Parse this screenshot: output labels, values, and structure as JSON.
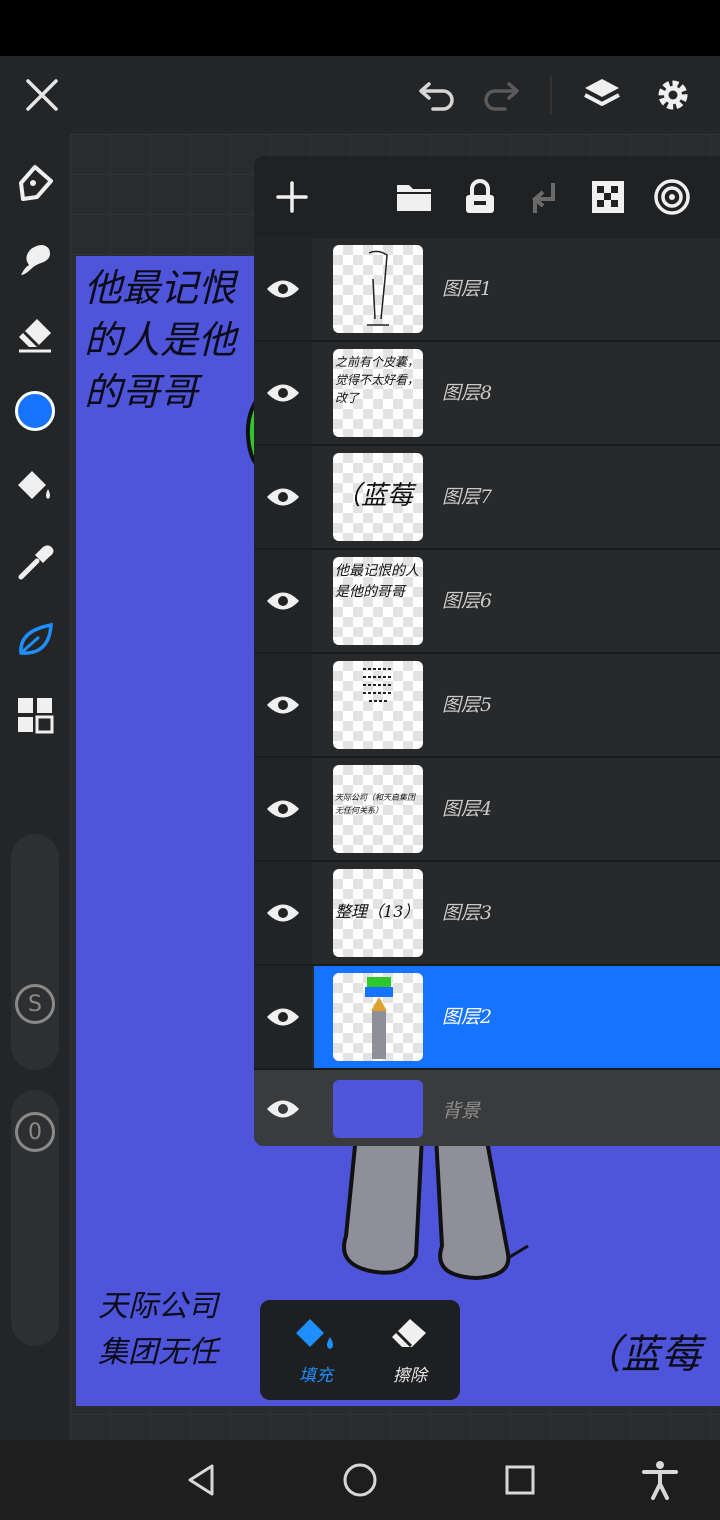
{
  "toolbar": {
    "icons": [
      "close-icon",
      "undo-icon",
      "redo-icon",
      "layers-icon",
      "settings-icon"
    ]
  },
  "sidebar": {
    "tools": [
      "pen-tool-icon",
      "smudge-tool-icon",
      "eraser-tool-icon",
      "color-picker",
      "fill-bucket-icon",
      "eyedropper-icon",
      "leaf-brush-icon",
      "grid-icon"
    ],
    "current_color": "#1673ff",
    "size_slider_label": "S",
    "opacity_slider_label": "0"
  },
  "canvas": {
    "background_color": "#4e55db",
    "text_top": "他最记恨的人是他的哥哥",
    "text_bottom": "天际公司\n集团无任",
    "text_right": "（蓝莓"
  },
  "layers_panel": {
    "toolbar_icons": [
      "add-layer-icon",
      "folder-icon",
      "lock-icon",
      "merge-down-icon",
      "transparency-icon",
      "blend-icon"
    ],
    "layers": [
      {
        "name": "图层1",
        "thumb_text": "",
        "selected": false
      },
      {
        "name": "图层8",
        "thumb_text": "之前有个皮囊，觉得不太好看，改了",
        "selected": false
      },
      {
        "name": "图层7",
        "thumb_text": "（蓝莓",
        "selected": false
      },
      {
        "name": "图层6",
        "thumb_text": "他最记恨的人是他的哥哥",
        "selected": false
      },
      {
        "name": "图层5",
        "thumb_text": "",
        "selected": false
      },
      {
        "name": "图层4",
        "thumb_text": "天际公司（和天启集团无任何关系）",
        "selected": false
      },
      {
        "name": "图层3",
        "thumb_text": "整理（13）",
        "selected": false
      },
      {
        "name": "图层2",
        "thumb_text": "",
        "selected": true
      }
    ],
    "background_layer": {
      "name": "背景",
      "color": "#4e55db"
    }
  },
  "fill_popup": {
    "fill_label": "填充",
    "erase_label": "擦除",
    "accent": "#1e8fff"
  },
  "navbar": {
    "icons": [
      "back-icon",
      "home-icon",
      "recents-icon",
      "accessibility-icon"
    ]
  }
}
